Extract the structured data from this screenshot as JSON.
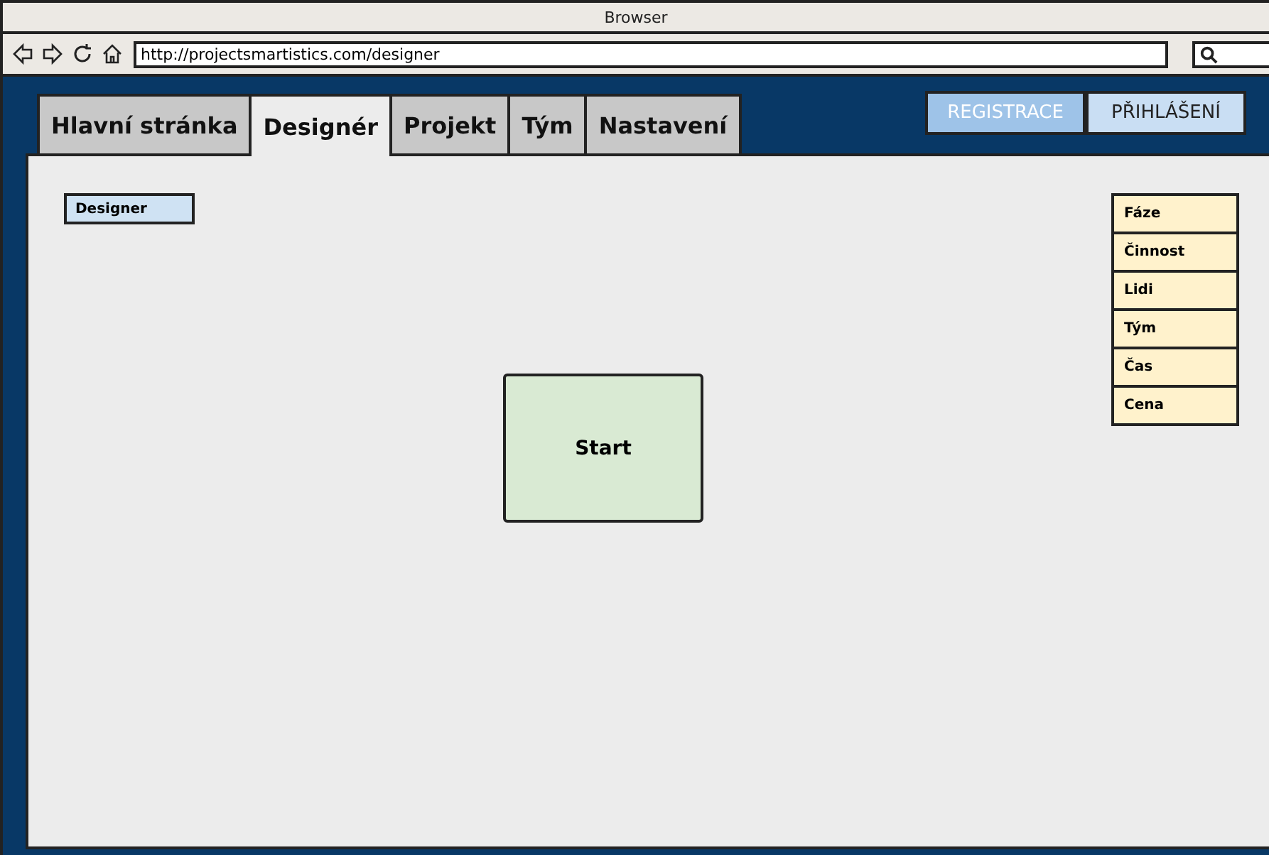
{
  "window": {
    "title": "Browser"
  },
  "address_bar": {
    "value": "http://projectsmartistics.com/designer"
  },
  "tabs": [
    {
      "label": "Hlavní stránka",
      "selected": false
    },
    {
      "label": "Designér",
      "selected": true
    },
    {
      "label": "Projekt",
      "selected": false
    },
    {
      "label": "Tým",
      "selected": false
    },
    {
      "label": "Nastavení",
      "selected": false
    }
  ],
  "header_buttons": [
    {
      "label": "REGISTRACE",
      "selected": true
    },
    {
      "label": "PŘIHLÁŠENÍ",
      "selected": false
    }
  ],
  "designer_label": "Designer",
  "palette": [
    "Fáze",
    "Činnost",
    "Lidi",
    "Tým",
    "Čas",
    "Cena"
  ],
  "canvas_nodes": [
    {
      "label": "Start"
    }
  ]
}
